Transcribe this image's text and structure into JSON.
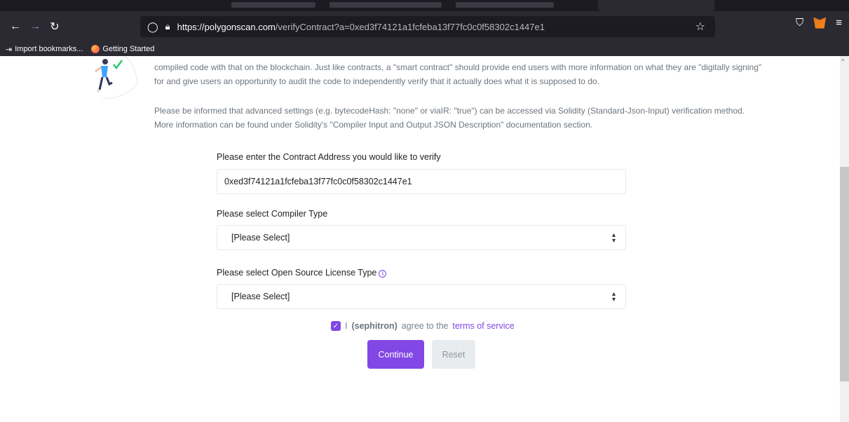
{
  "browser": {
    "url_domain": "https://polygonscan.com",
    "url_rest": "/verifyContract?a=0xed3f74121a1fcfeba13f77fc0c0f58302c1447e1",
    "bookmarks": [
      "Import bookmarks...",
      "Getting Started"
    ]
  },
  "content": {
    "paragraph1": "compiled code with that on the blockchain. Just like contracts, a \"smart contract\" should provide end users with more information on what they are \"digitally signing\" for and give users an opportunity to audit the code to independently verify that it actually does what it is supposed to do.",
    "paragraph2": "Please be informed that advanced settings (e.g. bytecodeHash: \"none\" or viaIR: \"true\") can be accessed via Solidity (Standard-Json-Input) verification method. More information can be found under Solidity's \"Compiler Input and Output JSON Description\" documentation section.",
    "address_label": "Please enter the Contract Address you would like to verify",
    "address_value": "0xed3f74121a1fcfeba13f77fc0c0f58302c1447e1",
    "compiler_label": "Please select Compiler Type",
    "compiler_value": "[Please Select]",
    "license_label": "Please select Open Source License Type",
    "license_value": "[Please Select]",
    "agree_prefix": "I",
    "username": "(sephitron)",
    "agree_middle": "agree to the",
    "terms_link": "terms of service",
    "continue_label": "Continue",
    "reset_label": "Reset"
  },
  "colors": {
    "accent": "#8247e5",
    "chrome_dark": "#1c1b22",
    "chrome": "#2b2a33"
  }
}
